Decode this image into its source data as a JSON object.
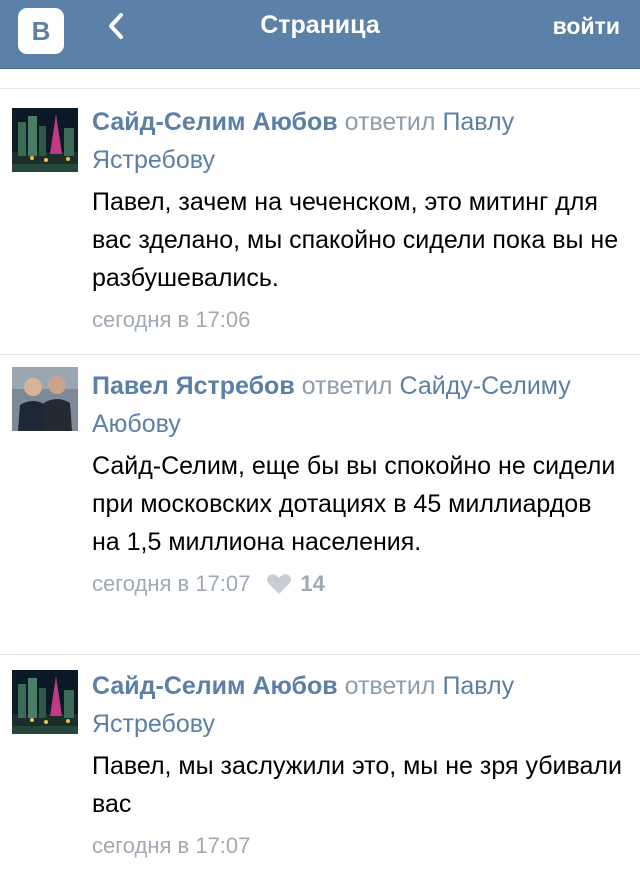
{
  "header": {
    "logo_text": "B",
    "title": "Страница",
    "login_label": "войти"
  },
  "colors": {
    "topbar": "#5b81a8",
    "link": "#5b7fa6",
    "meta": "#a1a9b2",
    "separator": "#e2e5ea"
  },
  "comments": [
    {
      "author": "Сайд-Селим Аюбов",
      "replied_word": "ответил",
      "reply_to": "Павлу Ястребову",
      "text": "Павел, зачем на чеченском, это митинг для вас зделано, мы спакойно сидели пока вы не разбушевались.",
      "time": "сегодня в 17:06",
      "avatar": "city-night-icon"
    },
    {
      "author": "Павел Ястребов",
      "replied_word": "ответил",
      "reply_to": "Сайду-Селиму Аюбову",
      "text": "Сайд-Селим, еще бы вы спокойно не сидели при московских дотациях в 45 миллиардов на 1,5 миллиона населения.",
      "time": "сегодня в 17:07",
      "likes": "14",
      "avatar": "two-men-photo-icon"
    },
    {
      "author": "Сайд-Селим Аюбов",
      "replied_word": "ответил",
      "reply_to": "Павлу Ястребову",
      "text": "Павел, мы заслужили это, мы не зря убивали вас",
      "time": "сегодня в 17:07",
      "avatar": "city-night-icon"
    }
  ]
}
